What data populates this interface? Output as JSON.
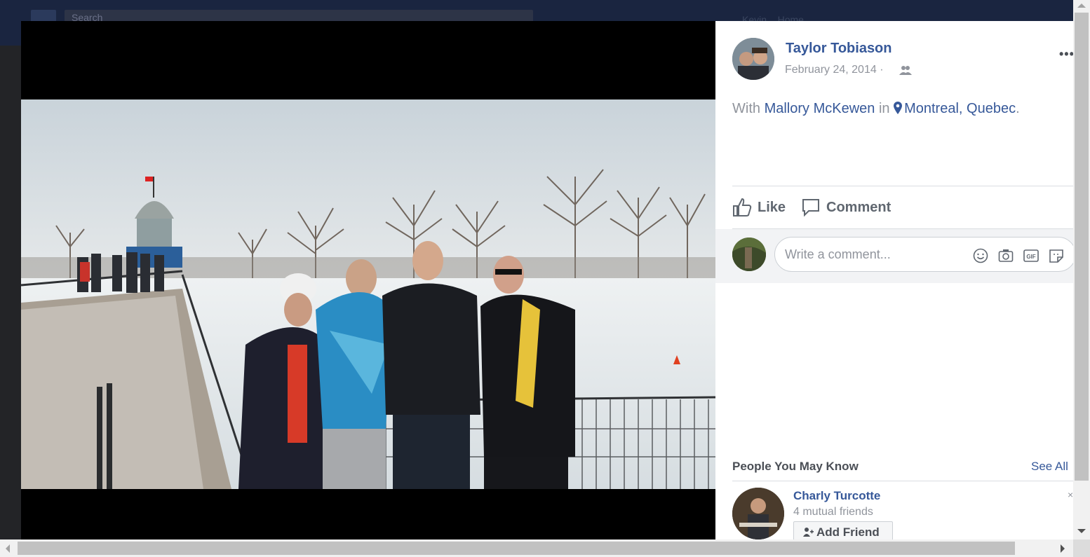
{
  "topbar": {
    "search_placeholder": "Search",
    "user_short": "Kevin",
    "home_label": "Home"
  },
  "post": {
    "author_name": "Taylor Tobiason",
    "date": "February 24, 2014",
    "date_separator": "·",
    "audience_icon": "friends-icon",
    "more_label": "•••",
    "with_prefix": "With",
    "tagged_person": "Mallory McKewen",
    "in_word": "in",
    "location": "Montreal, Quebec",
    "period": "."
  },
  "actions": {
    "like_label": "Like",
    "comment_label": "Comment"
  },
  "comment": {
    "placeholder": "Write a comment...",
    "icons": [
      "emoji-icon",
      "camera-icon",
      "gif-icon",
      "sticker-icon"
    ],
    "gif_text": "GIF"
  },
  "pymk": {
    "title": "People You May Know",
    "see_all": "See All",
    "person": {
      "name": "Charly Turcotte",
      "mutual": "4 mutual friends",
      "add_label": "Add Friend",
      "dismiss": "×"
    }
  },
  "colors": {
    "link": "#365899",
    "secondary_text": "#90949c",
    "action_text": "#606770"
  }
}
